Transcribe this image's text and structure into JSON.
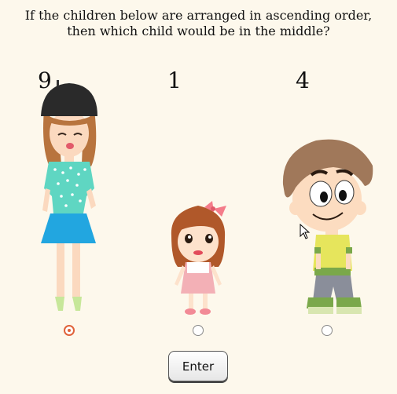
{
  "question": {
    "line1": "If the children below are arranged in ascending order,",
    "line2": "then which child would be in the middle?"
  },
  "children": [
    {
      "number": "9",
      "icon": "girl-tall-icon",
      "selected": true
    },
    {
      "number": "1",
      "icon": "girl-small-icon",
      "selected": false
    },
    {
      "number": "4",
      "icon": "boy-icon",
      "selected": false
    }
  ],
  "enter_label": "Enter",
  "colors": {
    "background": "#fdf8ec",
    "selected_radio": "#e0623a"
  }
}
